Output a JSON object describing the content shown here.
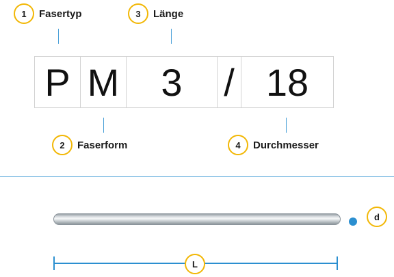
{
  "callouts": [
    {
      "number": "1",
      "label": "Fasertyp"
    },
    {
      "number": "3",
      "label": "Länge"
    },
    {
      "number": "2",
      "label": "Faserform"
    },
    {
      "number": "4",
      "label": "Durchmesser"
    }
  ],
  "code": {
    "fiber_type": "P",
    "fiber_form": "M",
    "length": "3",
    "separator": "/",
    "diameter": "18"
  },
  "dimensions": {
    "diameter_symbol": "d",
    "length_symbol": "L"
  },
  "colors": {
    "badge_border": "#f2b705",
    "accent_blue": "#2b8fd0",
    "line_blue": "#4aa0d8"
  }
}
